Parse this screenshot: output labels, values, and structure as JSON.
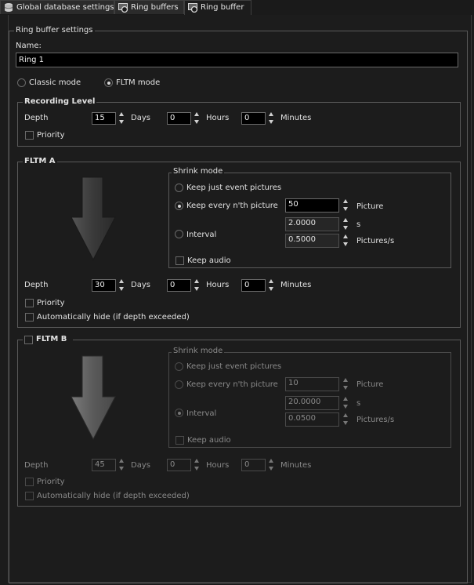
{
  "tabs": [
    {
      "label": "Global database settings",
      "icon": "database-icon"
    },
    {
      "label": "Ring buffers",
      "icon": "ring-buffers-icon"
    },
    {
      "label": "Ring buffer",
      "icon": "ring-buffer-icon",
      "active": true
    }
  ],
  "settings": {
    "group_title": "Ring buffer settings",
    "name_label": "Name:",
    "name_value": "Ring 1",
    "modes": [
      {
        "label": "Classic mode",
        "selected": false
      },
      {
        "label": "FLTM mode",
        "selected": true
      }
    ]
  },
  "recording": {
    "title": "Recording Level",
    "depth_label": "Depth",
    "days": "15",
    "days_label": "Days",
    "hours": "0",
    "hours_label": "Hours",
    "minutes": "0",
    "minutes_label": "Minutes",
    "priority_label": "Priority"
  },
  "fltm_a": {
    "title": "FLTM A",
    "shrink_title": "Shrink mode",
    "opt_event": "Keep just event pictures",
    "opt_nth": "Keep every n'th picture",
    "opt_interval": "Interval",
    "selected": "nth",
    "nth_value": "50",
    "picture_label": "Picture",
    "interval_s": "2.0000",
    "s_label": "s",
    "interval_rate": "0.5000",
    "rate_label": "Pictures/s",
    "keep_audio": "Keep audio",
    "depth_label": "Depth",
    "days": "30",
    "days_label": "Days",
    "hours": "0",
    "hours_label": "Hours",
    "minutes": "0",
    "minutes_label": "Minutes",
    "priority_label": "Priority",
    "autohide_label": "Automatically hide (if depth exceeded)"
  },
  "fltm_b": {
    "title": "FLTM B",
    "enabled": false,
    "shrink_title": "Shrink mode",
    "opt_event": "Keep just event pictures",
    "opt_nth": "Keep every n'th picture",
    "opt_interval": "Interval",
    "selected": "interval",
    "nth_value": "10",
    "picture_label": "Picture",
    "interval_s": "20.0000",
    "s_label": "s",
    "interval_rate": "0.0500",
    "rate_label": "Pictures/s",
    "keep_audio": "Keep audio",
    "depth_label": "Depth",
    "days": "45",
    "days_label": "Days",
    "hours": "0",
    "hours_label": "Hours",
    "minutes": "0",
    "minutes_label": "Minutes",
    "priority_label": "Priority",
    "autohide_label": "Automatically hide (if depth exceeded)"
  },
  "colors": {
    "background": "#1c1c1c",
    "input": "#000000",
    "border": "#5a5a5a",
    "text": "#e2e2e2",
    "disabled": "#8a8a8a"
  }
}
